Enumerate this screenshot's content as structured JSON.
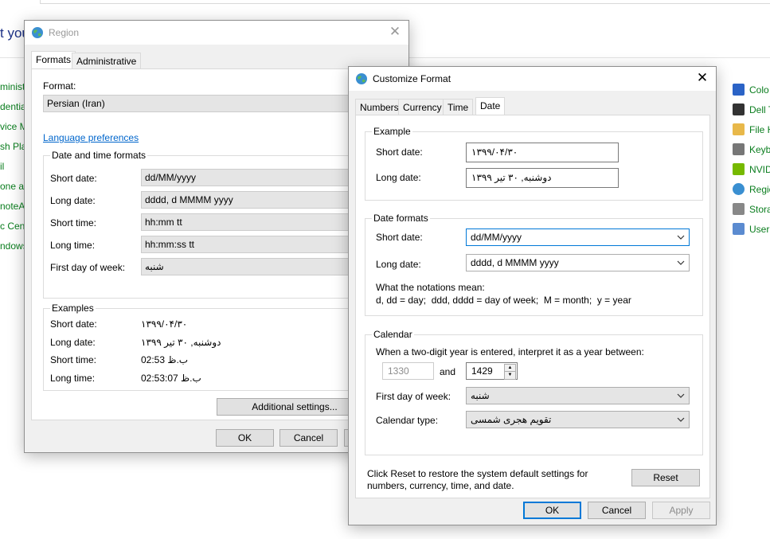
{
  "background": {
    "heading": "t you",
    "left_items": [
      "ministr",
      "dentia",
      "vice M",
      "sh Play",
      "il",
      "one an",
      "noteA",
      "c Cent",
      "ndows"
    ],
    "right_items": [
      {
        "label": "Colo",
        "icon": "monitor-icon",
        "color": "#2b63c6"
      },
      {
        "label": "Dell T",
        "icon": "dell-icon",
        "color": "#333333"
      },
      {
        "label": "File H",
        "icon": "file-history-icon",
        "color": "#e8b84a"
      },
      {
        "label": "Keyb",
        "icon": "keyboard-icon",
        "color": "#777777"
      },
      {
        "label": "NVID",
        "icon": "nvidia-icon",
        "color": "#76b900"
      },
      {
        "label": "Regio",
        "icon": "region-icon",
        "color": "#3a8fd1"
      },
      {
        "label": "Stora",
        "icon": "storage-icon",
        "color": "#888888"
      },
      {
        "label": "User",
        "icon": "users-icon",
        "color": "#5b8bd0"
      }
    ]
  },
  "region": {
    "title": "Region",
    "tabs": [
      "Formats",
      "Administrative"
    ],
    "format_label": "Format:",
    "format_value": "Persian (Iran)",
    "language_link": "Language preferences",
    "datetime_group": "Date and time formats",
    "fields": [
      {
        "label": "Short date:",
        "value": "dd/MM/yyyy"
      },
      {
        "label": "Long date:",
        "value": "dddd, d MMMM yyyy"
      },
      {
        "label": "Short time:",
        "value": "hh:mm tt"
      },
      {
        "label": "Long time:",
        "value": "hh:mm:ss tt"
      },
      {
        "label": "First day of week:",
        "value": "شنبه"
      }
    ],
    "examples_group": "Examples",
    "examples": [
      {
        "label": "Short date:",
        "value": "۱۳۹۹/۰۴/۳۰"
      },
      {
        "label": "Long date:",
        "value": "دوشنبه, ۳۰ تیر ۱۳۹۹"
      },
      {
        "label": "Short time:",
        "value": "ب.ظ 02:53"
      },
      {
        "label": "Long time:",
        "value": "ب.ظ 02:53:07"
      }
    ],
    "additional_button": "Additional settings...",
    "ok": "OK",
    "cancel": "Cancel"
  },
  "customize": {
    "title": "Customize Format",
    "tabs": [
      "Numbers",
      "Currency",
      "Time",
      "Date"
    ],
    "example_group": "Example",
    "example_short_label": "Short date:",
    "example_short_value": "۱۳۹۹/۰۴/۳۰",
    "example_long_label": "Long date:",
    "example_long_value": "دوشنبه, ۳۰ تیر ۱۳۹۹",
    "formats_group": "Date formats",
    "short_date_label": "Short date:",
    "short_date_value": "dd/MM/yyyy",
    "long_date_label": "Long date:",
    "long_date_value": "dddd, d MMMM yyyy",
    "notation_title": "What the notations mean:",
    "notation_text": "d, dd = day;  ddd, dddd = day of week;  M = month;  y = year",
    "calendar_group": "Calendar",
    "two_digit_text": "When a two-digit year is entered, interpret it as a year between:",
    "year_from": "1330",
    "and_label": "and",
    "year_to": "1429",
    "first_day_label": "First day of week:",
    "first_day_value": "شنبه",
    "calendar_type_label": "Calendar type:",
    "calendar_type_value": "تقویم هجری شمسی",
    "reset_text": "Click Reset to restore the system default settings for numbers, currency, time, and date.",
    "reset": "Reset",
    "ok": "OK",
    "cancel": "Cancel",
    "apply": "Apply"
  }
}
